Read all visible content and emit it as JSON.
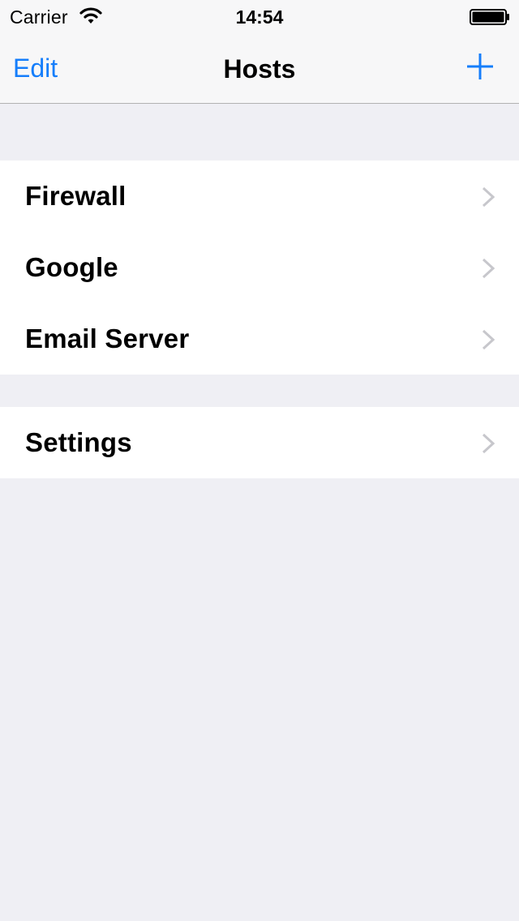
{
  "status_bar": {
    "carrier": "Carrier",
    "time": "14:54",
    "icons": [
      "wifi-icon",
      "battery-icon"
    ]
  },
  "nav_bar": {
    "edit_label": "Edit",
    "title": "Hosts",
    "add_icon": "plus-icon"
  },
  "hosts": [
    {
      "label": "Firewall"
    },
    {
      "label": "Google"
    },
    {
      "label": "Email Server"
    }
  ],
  "settings": {
    "label": "Settings"
  },
  "colors": {
    "accent": "#157efb",
    "background": "#efeff4",
    "chevron": "#c7c7cc"
  }
}
